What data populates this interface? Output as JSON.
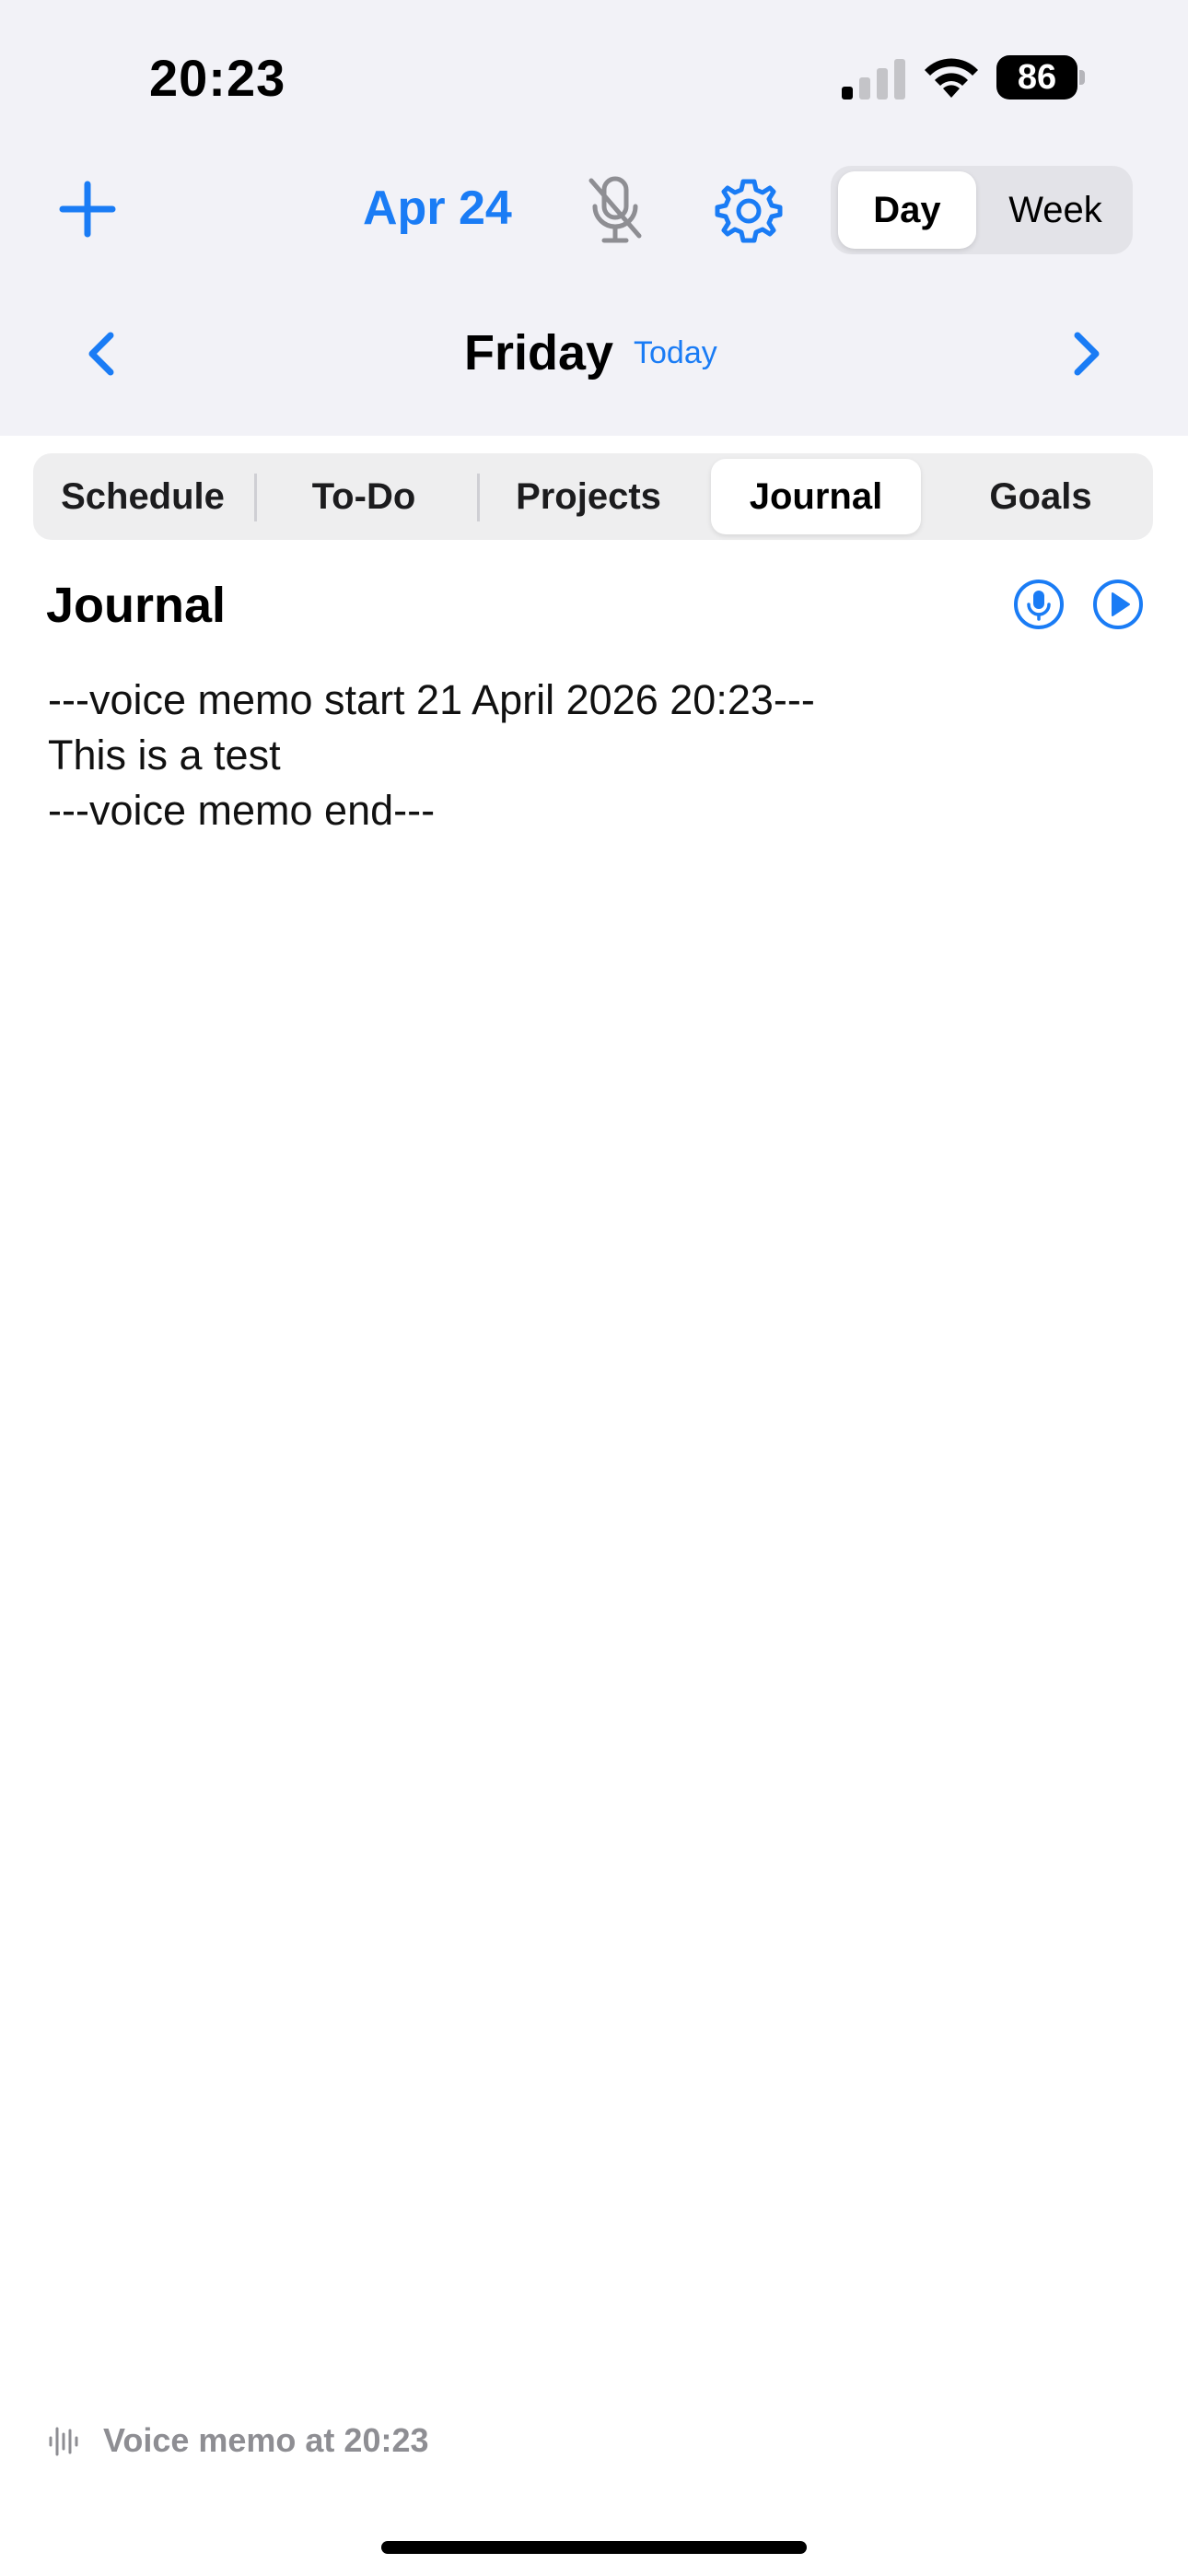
{
  "status_bar": {
    "time": "20:23",
    "battery": "86"
  },
  "toolbar": {
    "date": "Apr 24",
    "view_options": [
      "Day",
      "Week"
    ],
    "selected_view": "Day"
  },
  "day_nav": {
    "day_name": "Friday",
    "today_label": "Today"
  },
  "tabs": [
    "Schedule",
    "To-Do",
    "Projects",
    "Journal",
    "Goals"
  ],
  "selected_tab": "Journal",
  "journal": {
    "title": "Journal",
    "lines": [
      "---voice memo start 21 April 2026 20:23---",
      "This is a test",
      "---voice memo end---"
    ]
  },
  "footer": {
    "voice_memo_label": "Voice memo at 20:23"
  },
  "colors": {
    "accent": "#1a7cf5",
    "header_bg": "#f2f2f7",
    "muted": "#8e8e93"
  }
}
